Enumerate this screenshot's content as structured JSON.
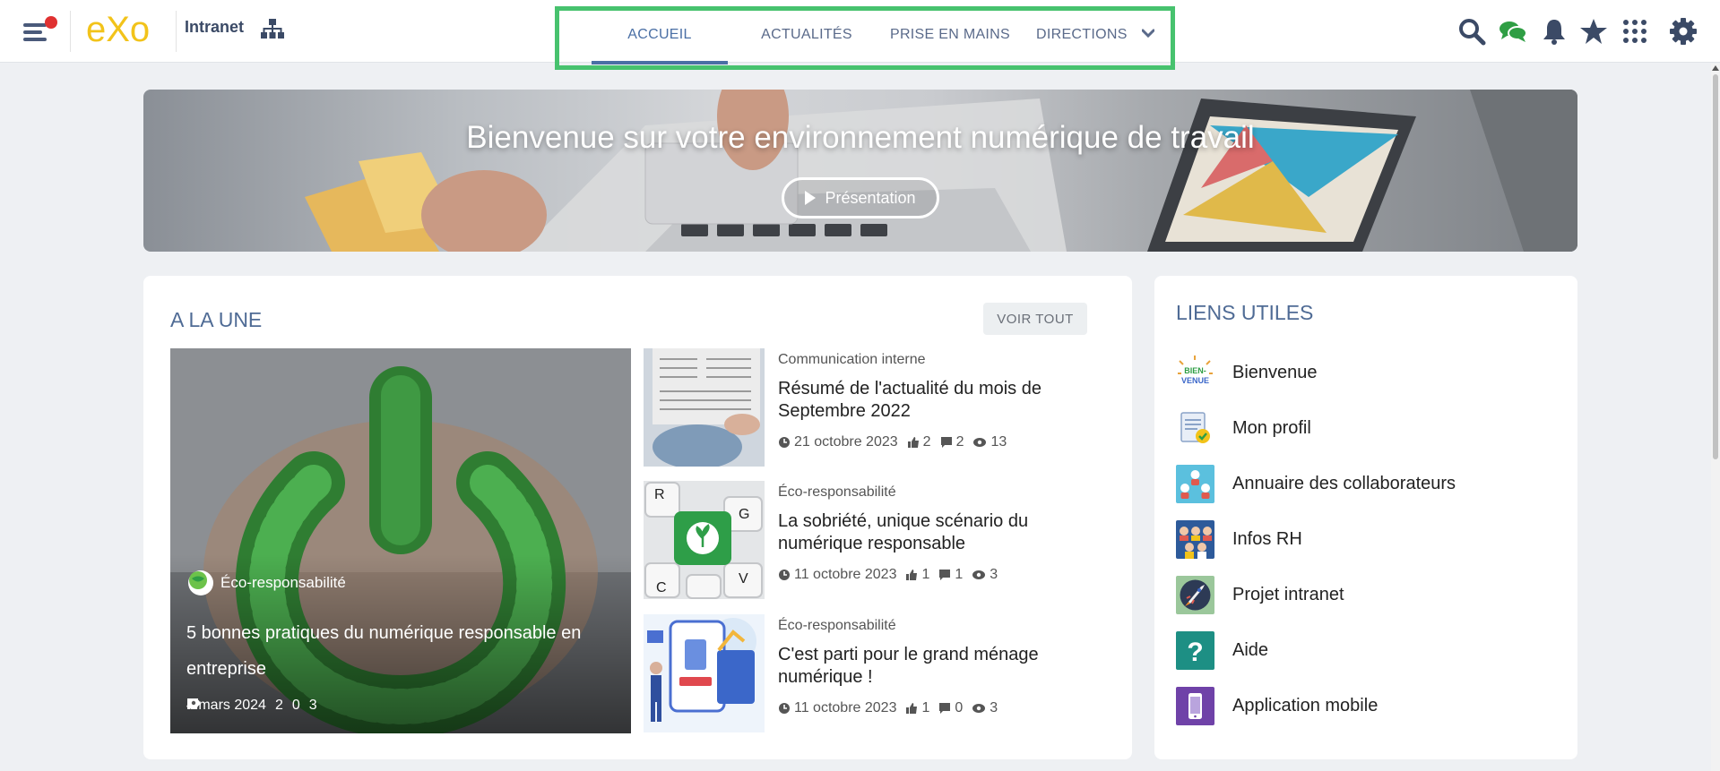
{
  "app": {
    "logo_text": "eXo",
    "site_name": "Intranet"
  },
  "nav": {
    "tabs": [
      {
        "label": "ACCUEIL",
        "active": true
      },
      {
        "label": "ACTUALITÉS",
        "active": false
      },
      {
        "label": "PRISE EN MAINS",
        "active": false
      },
      {
        "label": "DIRECTIONS",
        "active": false,
        "has_dropdown": true
      }
    ]
  },
  "top_icons": [
    "search-icon",
    "chat-icon",
    "bell-icon",
    "star-icon",
    "apps-grid-icon",
    "gear-icon"
  ],
  "banner": {
    "title": "Bienvenue sur votre environnement numérique de travail",
    "button_label": "Présentation"
  },
  "une": {
    "title": "A LA UNE",
    "voir_tout": "VOIR TOUT",
    "featured": {
      "category": "Éco-responsabilité",
      "title": "5 bonnes pratiques du numérique responsable en entreprise",
      "date": "4 mars 2024",
      "likes": "2",
      "comments": "0",
      "views": "3"
    },
    "articles": [
      {
        "category": "Communication interne",
        "title": "Résumé de l'actualité du mois de Septembre 2022",
        "date": "21 octobre 2023",
        "likes": "2",
        "comments": "2",
        "views": "13"
      },
      {
        "category": "Éco-responsabilité",
        "title": "La sobriété, unique scénario du numérique responsable",
        "date": "11 octobre 2023",
        "likes": "1",
        "comments": "1",
        "views": "3"
      },
      {
        "category": "Éco-responsabilité",
        "title": "C'est parti pour le grand ménage numérique !",
        "date": "11 octobre 2023",
        "likes": "1",
        "comments": "0",
        "views": "3"
      }
    ]
  },
  "liens": {
    "title": "LIENS UTILES",
    "items": [
      {
        "label": "Bienvenue",
        "icon": "bienvenue-icon",
        "icon_text": "BIEN-VENUE"
      },
      {
        "label": "Mon profil",
        "icon": "profile-certificate-icon"
      },
      {
        "label": "Annuaire des collaborateurs",
        "icon": "directory-icon"
      },
      {
        "label": "Infos RH",
        "icon": "hr-people-icon"
      },
      {
        "label": "Projet intranet",
        "icon": "rocket-icon"
      },
      {
        "label": "Aide",
        "icon": "help-icon",
        "icon_text": "?"
      },
      {
        "label": "Application mobile",
        "icon": "mobile-phone-icon"
      }
    ]
  },
  "colors": {
    "accent": "#4a6fa5",
    "highlight_border": "#47c26e",
    "notification_dot": "#e03131",
    "logo_yellow": "#f2c31a"
  }
}
